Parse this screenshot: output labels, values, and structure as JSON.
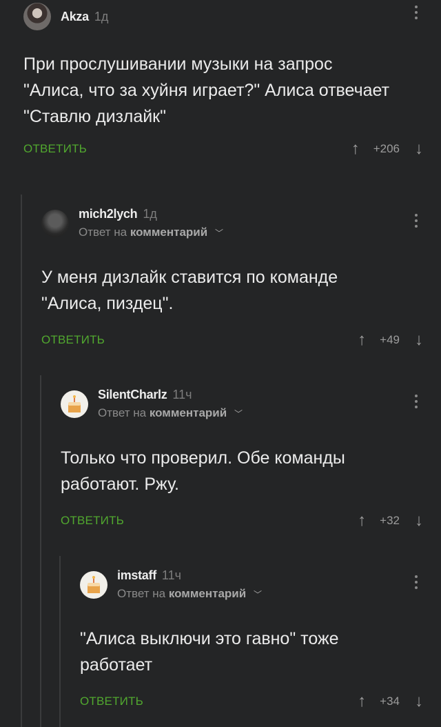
{
  "comments": [
    {
      "username": "Akza",
      "time": "1д",
      "reply_to": null,
      "text": "При прослушивании музыки на запрос \"Алиса, что за хуйня играет?\" Алиса отвечает \"Ставлю дизлайк\"",
      "reply_label": "ОТВЕТИТЬ",
      "score": "+206",
      "avatar": "woman-photo"
    },
    {
      "username": "mich2lych",
      "time": "1д",
      "reply_to": {
        "prefix": "Ответ на",
        "target": "комментарий"
      },
      "text": "У меня дизлайк ставится по команде \"Алиса, пиздец\".",
      "reply_label": "ОТВЕТИТЬ",
      "score": "+49",
      "avatar": "dark-photo"
    },
    {
      "username": "SilentCharlz",
      "time": "11ч",
      "reply_to": {
        "prefix": "Ответ на",
        "target": "комментарий"
      },
      "text": "Только что проверил. Обе команды работают. Ржу.",
      "reply_label": "ОТВЕТИТЬ",
      "score": "+32",
      "avatar": "cake-icon"
    },
    {
      "username": "imstaff",
      "time": "11ч",
      "reply_to": {
        "prefix": "Ответ на",
        "target": "комментарий"
      },
      "text": "\"Алиса выключи это гавно\" тоже работает",
      "reply_label": "ОТВЕТИТЬ",
      "score": "+34",
      "avatar": "cake-icon"
    }
  ],
  "icons": {
    "upvote": "arrow-up-icon",
    "downvote": "arrow-down-icon",
    "more": "vertical-dots-icon",
    "expand": "chevron-down-icon"
  },
  "colors": {
    "background": "#242526",
    "reply_button": "#51a82f",
    "thread_line": "#3a3b3c"
  }
}
